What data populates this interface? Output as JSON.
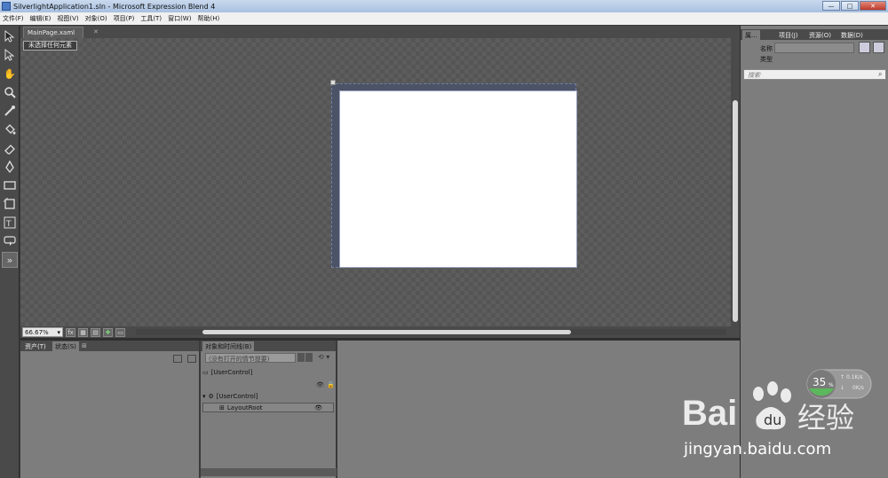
{
  "window": {
    "title": "SilverlightApplication1.sln - Microsoft Expression Blend 4",
    "min_label": "—",
    "max_label": "□",
    "close_label": "✕"
  },
  "menu": [
    "文件(F)",
    "编辑(E)",
    "视图(V)",
    "对象(O)",
    "项目(P)",
    "工具(T)",
    "窗口(W)",
    "帮助(H)"
  ],
  "document": {
    "tab_label": "MainPage.xaml",
    "selection_label": "未选择任何元素",
    "zoom_value": "66.67%"
  },
  "bottom_left": {
    "tabs": [
      "资产(T)",
      "状态(S)"
    ]
  },
  "objects_timeline": {
    "tab_label": "对象和时间线(B)",
    "storyboard_placeholder": "(没有打开的情节提要)",
    "rows": [
      "[UserControl]",
      "[UserControl]",
      "LayoutRoot"
    ]
  },
  "properties": {
    "tabs": [
      "属...",
      "项目(J)",
      "资源(O)",
      "数据(D)"
    ],
    "name_label": "名称",
    "type_label": "类型",
    "search_placeholder": "搜索"
  },
  "perf_widget": {
    "percent": "35",
    "percent_unit": "%",
    "up_speed": "0.1K/s",
    "down_speed": "0K/s"
  },
  "watermark": {
    "logo_text": "Bai",
    "logo_cn": "经验",
    "url": "jingyan.baidu.com"
  },
  "colors": {
    "canvas": "#ffffff",
    "panel": "#7d7d7d",
    "chrome": "#4a4a4a",
    "accent_green": "#5cb85c"
  }
}
